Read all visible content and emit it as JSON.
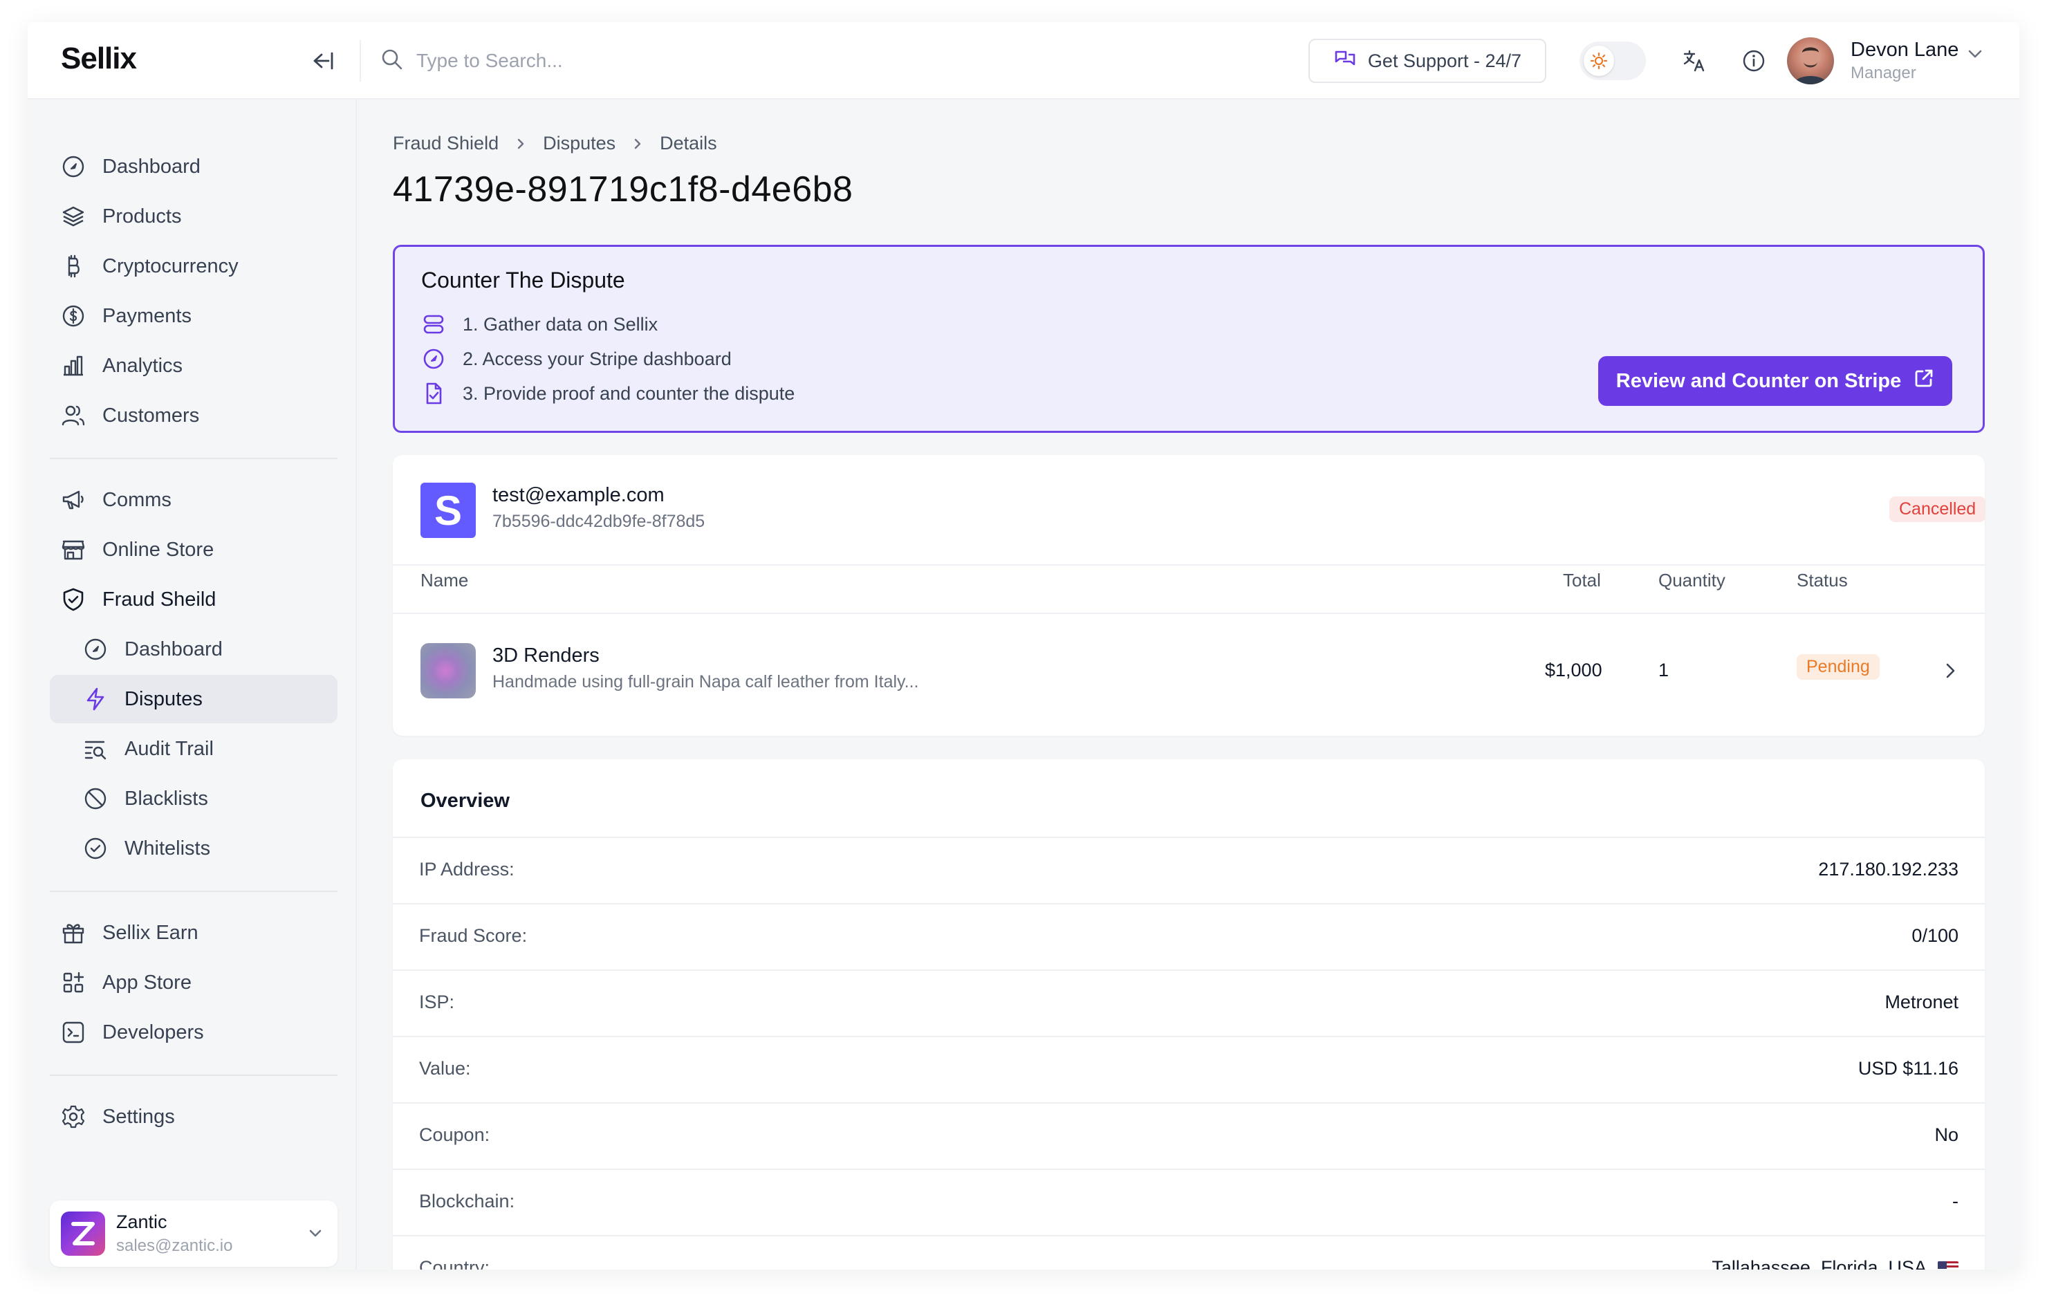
{
  "header": {
    "logo": "Sellix",
    "search_placeholder": "Type to Search...",
    "support_label": "Get Support - 24/7",
    "user": {
      "name": "Devon Lane",
      "role": "Manager"
    }
  },
  "sidebar": {
    "group1": [
      {
        "label": "Dashboard",
        "icon": "dashboard-icon"
      },
      {
        "label": "Products",
        "icon": "layers-icon"
      },
      {
        "label": "Cryptocurrency",
        "icon": "bitcoin-icon"
      },
      {
        "label": "Payments",
        "icon": "dollar-icon"
      },
      {
        "label": "Analytics",
        "icon": "bar-chart-icon"
      },
      {
        "label": "Customers",
        "icon": "users-icon"
      }
    ],
    "group2": [
      {
        "label": "Comms",
        "icon": "megaphone-icon"
      },
      {
        "label": "Online Store",
        "icon": "store-icon"
      },
      {
        "label": "Fraud Sheild",
        "icon": "shield-icon"
      }
    ],
    "fraud_sub": [
      {
        "label": "Dashboard",
        "icon": "dashboard-icon"
      },
      {
        "label": "Disputes",
        "icon": "lightning-icon",
        "active": true
      },
      {
        "label": "Audit Trail",
        "icon": "audit-icon"
      },
      {
        "label": "Blacklists",
        "icon": "ban-icon"
      },
      {
        "label": "Whitelists",
        "icon": "check-circle-icon"
      }
    ],
    "group3": [
      {
        "label": "Sellix Earn",
        "icon": "gift-icon"
      },
      {
        "label": "App Store",
        "icon": "apps-icon"
      },
      {
        "label": "Developers",
        "icon": "terminal-icon"
      }
    ],
    "group4": [
      {
        "label": "Settings",
        "icon": "gear-icon"
      }
    ],
    "account": {
      "name": "Zantic",
      "email": "sales@zantic.io"
    }
  },
  "breadcrumb": [
    "Fraud Shield",
    "Disputes",
    "Details"
  ],
  "page_title": "41739e-891719c1f8-d4e6b8",
  "counter": {
    "title": "Counter The Dispute",
    "steps": [
      "1. Gather data on Sellix",
      "2. Access your Stripe dashboard",
      "3. Provide proof and counter the dispute"
    ],
    "button_label": "Review and Counter on Stripe"
  },
  "order": {
    "gateway_letter": "S",
    "customer_email": "test@example.com",
    "customer_id": "7b5596-ddc42db9fe-8f78d5",
    "status": "Cancelled",
    "columns": {
      "name": "Name",
      "total": "Total",
      "quantity": "Quantity",
      "status": "Status"
    },
    "product": {
      "name": "3D Renders",
      "description": "Handmade using full-grain Napa calf leather from Italy...",
      "total": "$1,000",
      "quantity": "1",
      "status": "Pending"
    }
  },
  "overview": {
    "title": "Overview",
    "rows": [
      {
        "label": "IP Address:",
        "value": "217.180.192.233"
      },
      {
        "label": "Fraud Score:",
        "value": "0/100"
      },
      {
        "label": "ISP:",
        "value": "Metronet"
      },
      {
        "label": "Value:",
        "value": "USD $11.16"
      },
      {
        "label": "Coupon:",
        "value": "No"
      },
      {
        "label": "Blockchain:",
        "value": "-"
      },
      {
        "label": "Country:",
        "value": "Tallahassee, Florida, USA"
      }
    ]
  },
  "colors": {
    "accent": "#6a3be4",
    "cancelled": "#e0413a",
    "pending": "#ea7a28"
  }
}
